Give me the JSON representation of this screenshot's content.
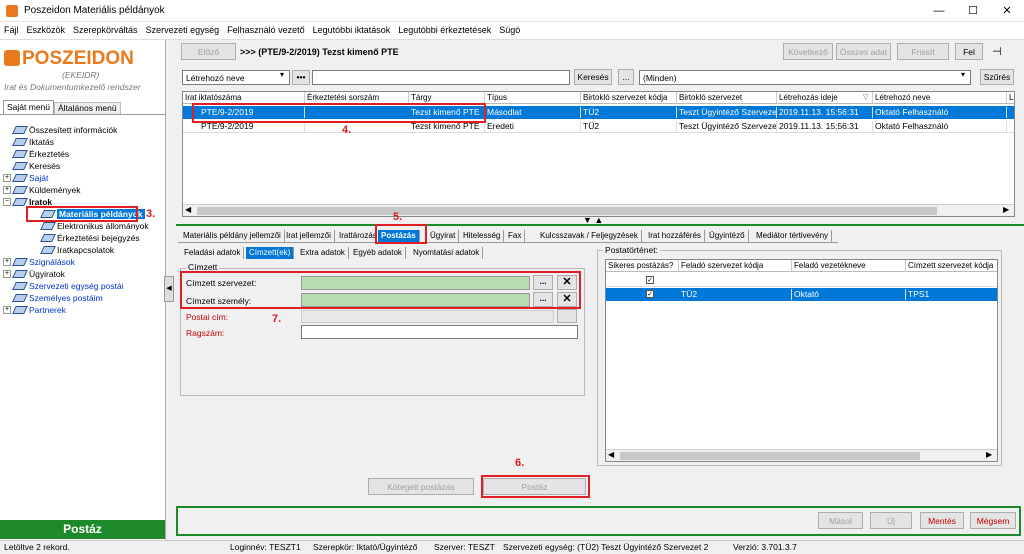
{
  "window": {
    "title": "Poszeidon Materiális példányok"
  },
  "menu": [
    "Fájl",
    "Eszközök",
    "Szerepkörváltás",
    "Szervezeti egység",
    "Felhasználó vezető",
    "Legutóbbi iktatások",
    "Legutóbbi érkeztetések",
    "Súgó"
  ],
  "logo": {
    "name": "POSZEIDON",
    "sub": "(EKEIDR)",
    "tagline": "Irat és Dokumentumkezelő rendszer"
  },
  "left_tabs": [
    "Saját menü",
    "Általános menü"
  ],
  "tree": [
    "Összesített információk",
    "Iktatás",
    "Érkeztetés",
    "Keresés",
    "Saját",
    "Küldemények",
    "Iratok",
    "Materiális példányok",
    "Elektronikus állományok",
    "Érkeztetési bejegyzés",
    "Iratkapcsolatok",
    "Szignálások",
    "Ügyiratok",
    "Szervezeti egység postái",
    "Személyes postáim",
    "Partnerek"
  ],
  "footer_label": "Postáz",
  "nav": {
    "prev": "Előző",
    "breadcrumb": ">>> (PTE/9-2/2019) Tezst kimenő PTE",
    "next": "Következő",
    "all": "Összes adat",
    "refresh": "Frissít",
    "up": "Fel"
  },
  "search": {
    "dropdown": "Létrehozó neve",
    "dots": "•••",
    "search_btn": "Keresés",
    "ellipsis": "...",
    "filter": "(Minden)",
    "clear": "Szűrés"
  },
  "grid": {
    "headers": [
      "Irat iktatószáma",
      "Érkeztetési sorszám",
      "Tárgy",
      "Típus",
      "Birtokló szervezet kódja",
      "Birtokló szervezet",
      "Létrehozás ideje",
      "Létrehozó neve",
      "L"
    ],
    "rows": [
      [
        "PTE/9-2/2019",
        "",
        "Tezst kimenő PTE",
        "Másodlat",
        "TÜ2",
        "Teszt Ügyintéző Szervezet",
        "2019.11.13. 15:56:31",
        "Oktató Felhasználó"
      ],
      [
        "PTE/9-2/2019",
        "",
        "Tezst kimenő PTE",
        "Eredeti",
        "TÜ2",
        "Teszt Ügyintéző Szervezet",
        "2019.11.13. 15:56:31",
        "Oktató Felhasználó"
      ]
    ]
  },
  "tabs": [
    "Materiális példány jellemzői",
    "Irat jellemzői",
    "Irattározás",
    "Postázás",
    "Ügyirat",
    "Hitelesség",
    "Fax",
    "Kulcsszavak / Feljegyzések",
    "Irat hozzáférés",
    "Ügyintéző",
    "Mediátor tértivevény"
  ],
  "subtabs": [
    "Feladási adatok",
    "Címzett(ek)",
    "Extra adatok",
    "Egyéb adatok",
    "Nyomtatási adatok"
  ],
  "cimzett": {
    "group": "Címzett",
    "szervezet": "Címzett szervezet:",
    "szemely": "Címzett személy:",
    "postai": "Postai cím:",
    "ragszam": "Ragszám:",
    "dots": "..."
  },
  "postatortenet": {
    "title": "Postatörténet:",
    "headers": [
      "Sikeres postázás?",
      "Feladó szervezet kódja",
      "Feladó vezetékneve",
      "Címzett szervezet kódja"
    ],
    "rows": [
      [
        "✓",
        "",
        "",
        ""
      ],
      [
        "✓",
        "TÜ2",
        "Oktató",
        "TPS1"
      ]
    ]
  },
  "bottom": {
    "kotegelt": "Kötegelt postázás",
    "postaz": "Postáz",
    "masol": "Másol",
    "uj": "Új",
    "mentes": "Mentés",
    "megsem": "Mégsem"
  },
  "annotations": [
    "3.",
    "4.",
    "5.",
    "6.",
    "7."
  ],
  "status": {
    "left": "Letöltve 2 rekord.",
    "login": "Loginnév: TESZT1",
    "role": "Szerepkör: Iktató/Ügyintéző",
    "server": "Szerver: TESZT",
    "unit": "Szervezeti egység: (TÜ2) Teszt Ügyintéző Szervezet 2",
    "version": "Verzió: 3.701.3.7"
  }
}
